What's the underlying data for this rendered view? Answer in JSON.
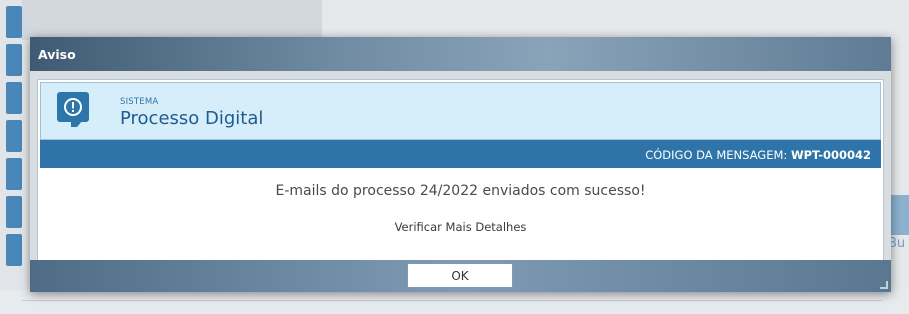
{
  "modal": {
    "title": "Aviso",
    "system_label": "SISTEMA",
    "system_name": "Processo Digital",
    "code_label": "CÓDIGO DA MENSAGEM:",
    "code_value": "WPT-000042",
    "message": "E-mails do processo 24/2022 enviados com sucesso!",
    "details_link": "Verificar Mais Detalhes",
    "ok_label": "OK"
  },
  "background": {
    "right_fragment": "Bu"
  },
  "colors": {
    "accent": "#2f74a9",
    "header_bg": "#d6eef9",
    "titlebar": "#5f7b95"
  },
  "icons": {
    "alert": "exclamation-circle-icon"
  }
}
